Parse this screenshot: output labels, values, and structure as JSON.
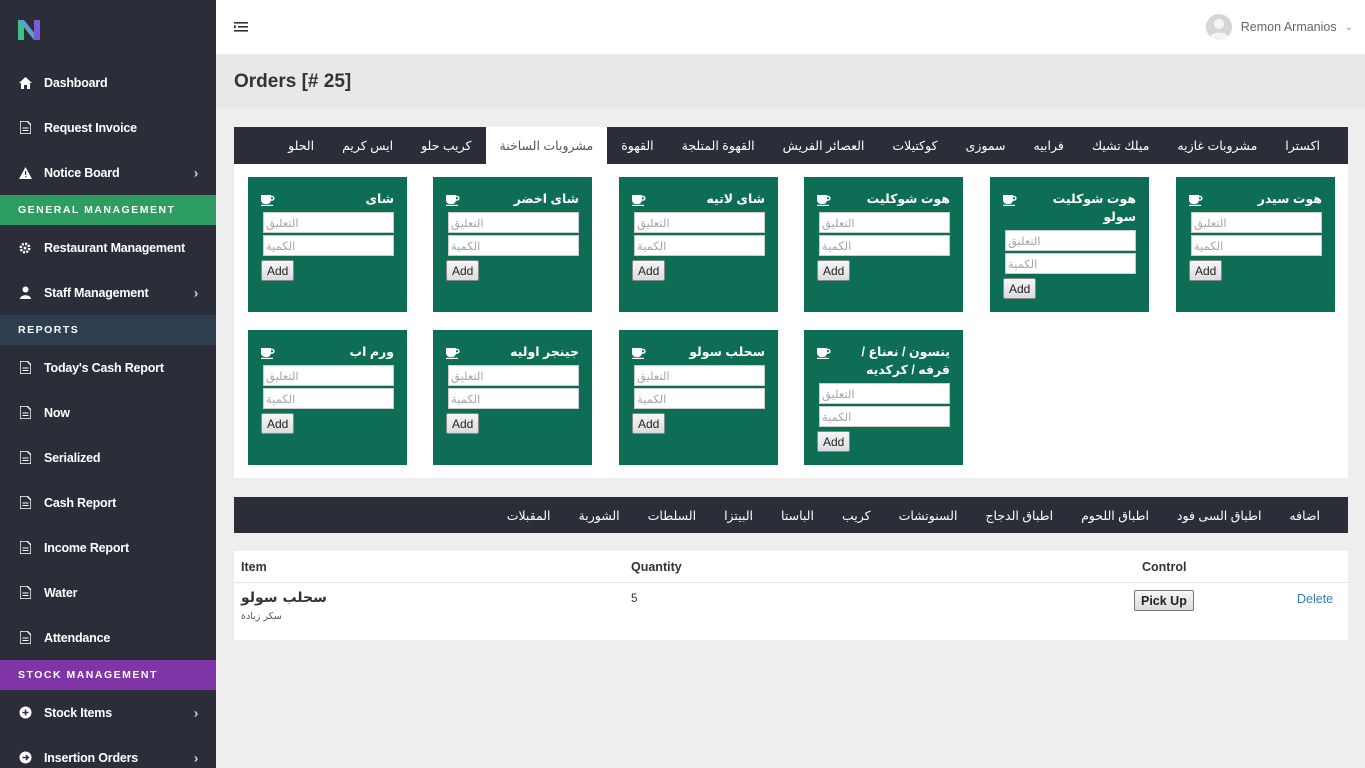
{
  "brand": {
    "logo": "N",
    "logo_colors": [
      "#3ec08a",
      "#7b5cd6"
    ]
  },
  "sidebar": {
    "items": [
      {
        "label": "Dashboard",
        "icon": "home-icon"
      },
      {
        "label": "Request Invoice",
        "icon": "document-icon"
      },
      {
        "label": "Notice Board",
        "icon": "warning-icon",
        "has_submenu": true
      }
    ],
    "section_general": "GENERAL MANAGEMENT",
    "general_items": [
      {
        "label": "Restaurant Management",
        "icon": "gear-icon"
      },
      {
        "label": "Staff Management",
        "icon": "user-icon",
        "has_submenu": true
      }
    ],
    "section_reports": "REPORTS",
    "report_items": [
      {
        "label": "Today's Cash Report",
        "icon": "document-icon"
      },
      {
        "label": "Now",
        "icon": "document-icon"
      },
      {
        "label": "Serialized",
        "icon": "document-icon"
      },
      {
        "label": "Cash Report",
        "icon": "document-icon"
      },
      {
        "label": "Income Report",
        "icon": "document-icon"
      },
      {
        "label": "Water",
        "icon": "document-icon"
      },
      {
        "label": "Attendance",
        "icon": "document-icon"
      }
    ],
    "section_stock": "STOCK MANAGEMENT",
    "stock_items": [
      {
        "label": "Stock Items",
        "icon": "plus-circle-icon",
        "has_submenu": true
      },
      {
        "label": "Insertion Orders",
        "icon": "arrow-right-circle-icon",
        "has_submenu": true
      }
    ]
  },
  "topbar": {
    "user_name": "Remon Armanios"
  },
  "page": {
    "title": "Orders [# 25]"
  },
  "drink_categories": [
    {
      "label": "اكسترا"
    },
    {
      "label": "مشروبات غازيه"
    },
    {
      "label": "ميلك تشيك"
    },
    {
      "label": "فرابيه"
    },
    {
      "label": "سموزى"
    },
    {
      "label": "كوكتيلات"
    },
    {
      "label": "العصائر الفريش"
    },
    {
      "label": "القهوة المتلجة"
    },
    {
      "label": "القهوة"
    },
    {
      "label": "مشروبات الساخنة",
      "active": true
    },
    {
      "label": "كريب حلو"
    },
    {
      "label": "ايس كريم"
    },
    {
      "label": "الحلو"
    }
  ],
  "form": {
    "comment_placeholder": "التعليق",
    "quantity_placeholder": "الكمية",
    "add_label": "Add"
  },
  "items": [
    {
      "name": "هوت سيدر"
    },
    {
      "name": "هوت شوكليت سولو"
    },
    {
      "name": "هوت شوكليت"
    },
    {
      "name": "شاى لاتيه"
    },
    {
      "name": "شاى اخضر"
    },
    {
      "name": "شاى"
    },
    {
      "name": "ينسون / نعناع / قرفه / كركديه"
    },
    {
      "name": "سحلب سولو"
    },
    {
      "name": "جينجر اوليه"
    },
    {
      "name": "ورم اب"
    }
  ],
  "food_categories": [
    {
      "label": "اضافه"
    },
    {
      "label": "اطباق السى فود"
    },
    {
      "label": "اطباق اللحوم"
    },
    {
      "label": "اطباق الدجاج"
    },
    {
      "label": "السنوتشات"
    },
    {
      "label": "كريب"
    },
    {
      "label": "الباستا"
    },
    {
      "label": "البيتزا"
    },
    {
      "label": "السلطات"
    },
    {
      "label": "الشوربة"
    },
    {
      "label": "المقبلات"
    }
  ],
  "order_table": {
    "headers": {
      "item": "Item",
      "quantity": "Quantity",
      "control": "Control"
    },
    "rows": [
      {
        "item": "سحلب سولو",
        "note": "سكر زيادة",
        "quantity": "5",
        "pickup_label": "Pick Up",
        "delete_label": "Delete"
      }
    ]
  },
  "colors": {
    "card": "#0e6e55",
    "sidebar": "#2b2e38",
    "general": "#2e9d62",
    "reports": "#2e3f52",
    "stock": "#7f35a5"
  }
}
